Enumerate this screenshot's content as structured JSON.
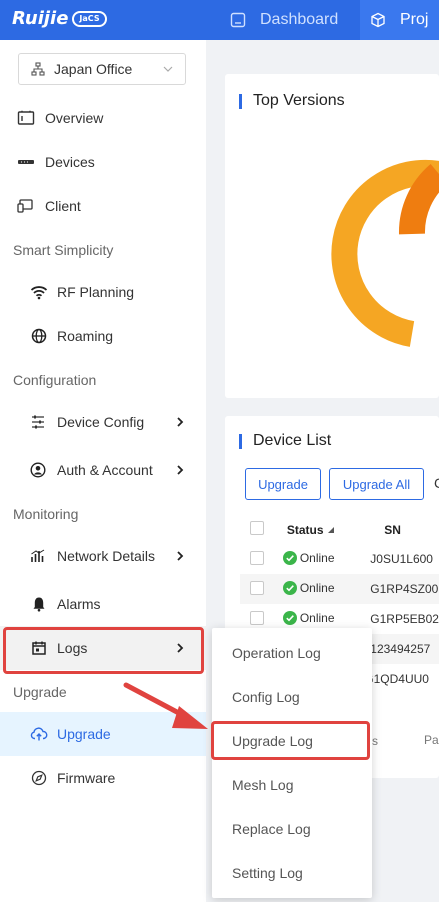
{
  "header": {
    "logo_text": "Ruijie",
    "logo_badge": "JaCS",
    "tabs": [
      {
        "label": "Dashboard",
        "icon": "dashboard-icon"
      },
      {
        "label": "Proj",
        "icon": "project-cube-icon"
      }
    ]
  },
  "sidebar": {
    "site_selector": {
      "value": "Japan Office"
    },
    "groups": {
      "smart_simplicity": "Smart Simplicity",
      "configuration": "Configuration",
      "monitoring": "Monitoring",
      "upgrade": "Upgrade"
    },
    "items": {
      "overview": "Overview",
      "devices": "Devices",
      "client": "Client",
      "rf_planning": "RF Planning",
      "roaming": "Roaming",
      "device_config": "Device Config",
      "auth_account": "Auth & Account",
      "network_details": "Network Details",
      "alarms": "Alarms",
      "logs": "Logs",
      "upgrade": "Upgrade",
      "firmware": "Firmware"
    }
  },
  "main": {
    "top_versions": {
      "title": "Top Versions"
    },
    "device_list": {
      "title": "Device List",
      "upgrade_button": "Upgrade",
      "upgrade_all_button": "Upgrade All",
      "toolbar_fragment": "C",
      "columns": [
        "Status",
        "SN"
      ],
      "rows": [
        {
          "status": "Online",
          "sn": "J0SU1L600"
        },
        {
          "status": "Online",
          "sn": "G1RP4SZ00"
        },
        {
          "status": "Online",
          "sn": "G1RP5EB02"
        },
        {
          "status": "",
          "sn": "123494257"
        },
        {
          "status": "",
          "sn": "G1QD4UU0"
        }
      ],
      "pager_fragment_1": "s",
      "pager_fragment_2": "Pa"
    }
  },
  "logs_menu": {
    "items": [
      "Operation Log",
      "Config Log",
      "Upgrade Log",
      "Mesh Log",
      "Replace Log",
      "Setting Log"
    ]
  },
  "colors": {
    "primary": "#2d6ae3",
    "highlight": "#e0433f",
    "online": "#3bb54a",
    "donut_orange": "#f59a0c"
  }
}
